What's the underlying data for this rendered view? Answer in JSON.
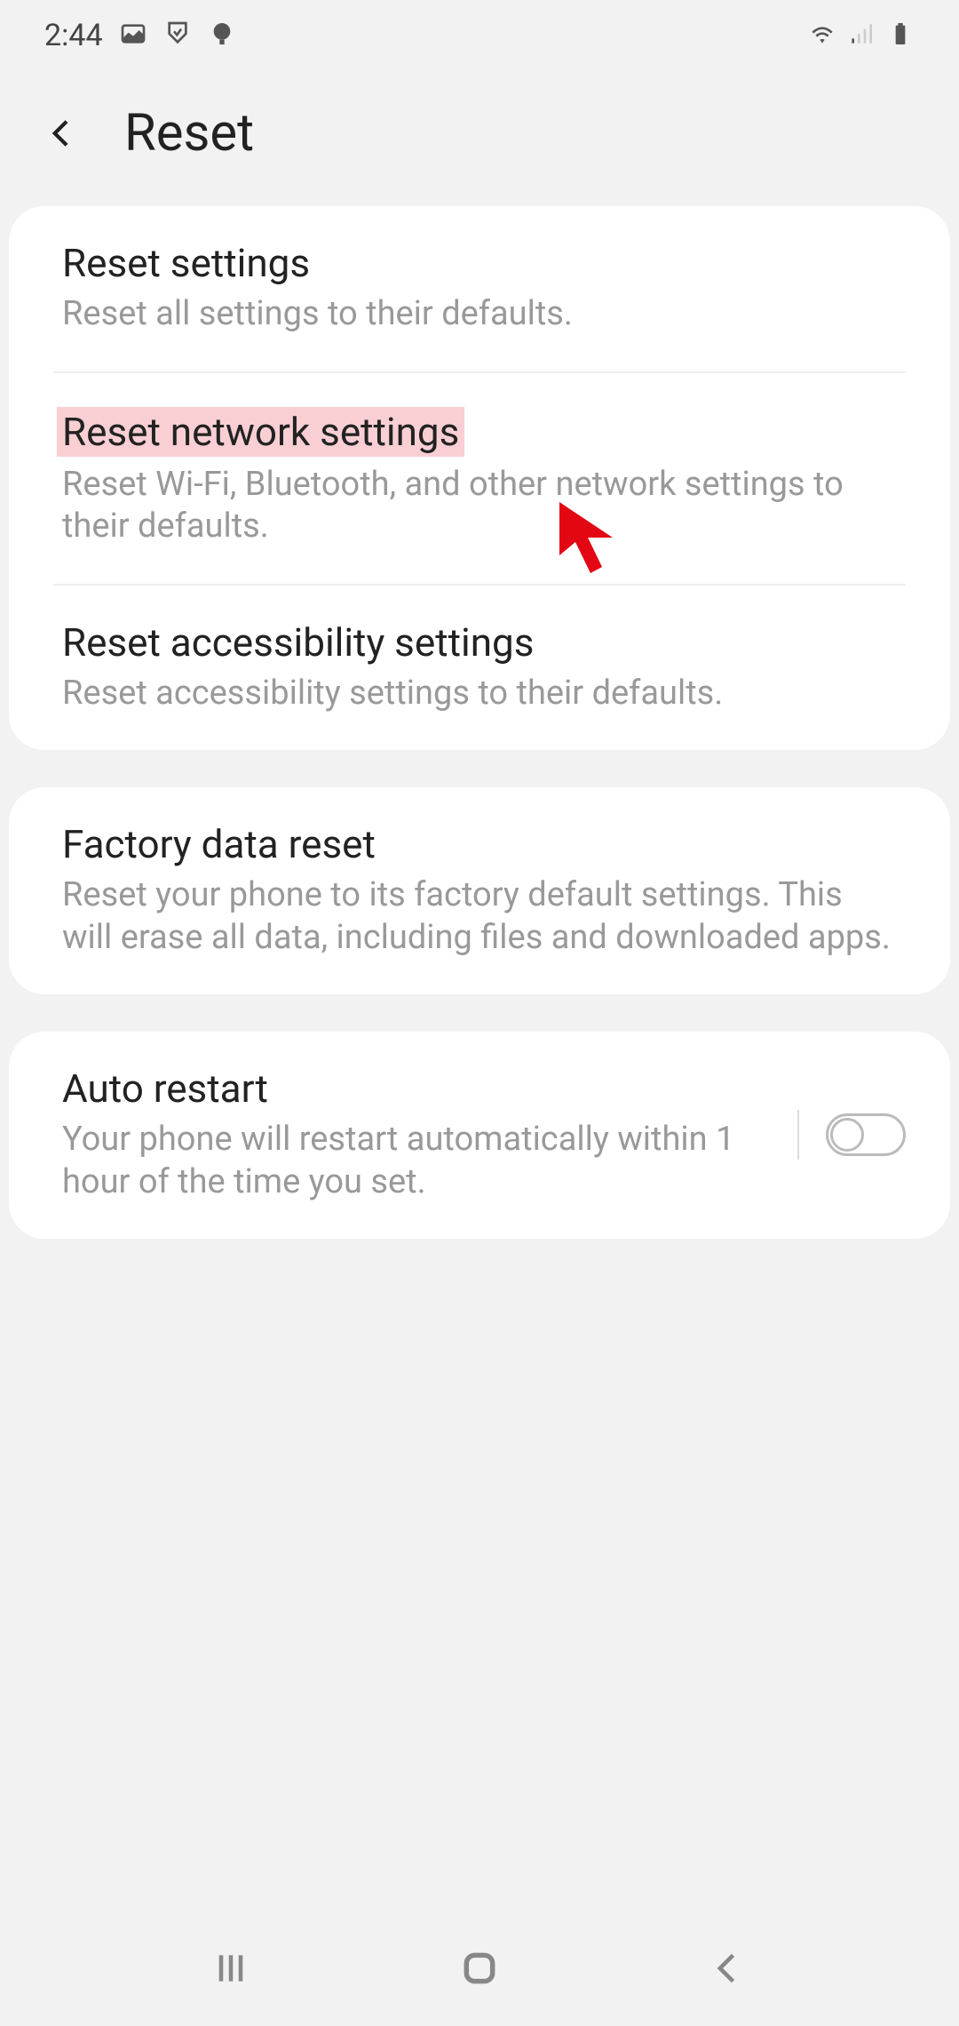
{
  "status": {
    "time": "2:44"
  },
  "header": {
    "title": "Reset"
  },
  "group1": {
    "items": [
      {
        "title": "Reset settings",
        "desc": "Reset all settings to their defaults."
      },
      {
        "title": "Reset network settings",
        "desc": "Reset Wi-Fi, Bluetooth, and other network settings to their defaults."
      },
      {
        "title": "Reset accessibility settings",
        "desc": "Reset accessibility settings to their defaults."
      }
    ]
  },
  "group2": {
    "items": [
      {
        "title": "Factory data reset",
        "desc": "Reset your phone to its factory default settings. This will erase all data, including files and downloaded apps."
      }
    ]
  },
  "group3": {
    "items": [
      {
        "title": "Auto restart",
        "desc": "Your phone will restart automatically within 1 hour of the time you set."
      }
    ]
  }
}
